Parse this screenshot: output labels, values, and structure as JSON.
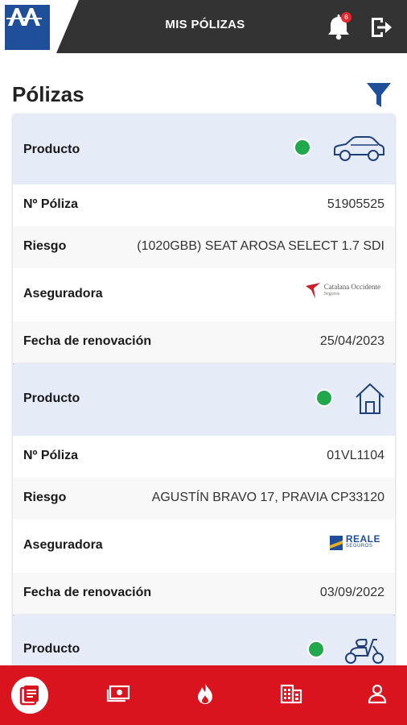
{
  "header": {
    "title": "MIS PÓLIZAS",
    "notification_count": "6",
    "brand_color": "#1f4f9a",
    "bar_color": "#333333"
  },
  "page": {
    "title": "Pólizas"
  },
  "policies": [
    {
      "product_label": "Producto",
      "product_icon": "car-icon",
      "status_color": "#21a84d",
      "rows": [
        {
          "key": "Nº Póliza",
          "value": "51905525"
        },
        {
          "key": "Riesgo",
          "value": "(1020GBB) SEAT AROSA SELECT 1.7 SDI"
        },
        {
          "key": "Aseguradora",
          "insurer": "Catalana Occidente",
          "insurer_sub": "Seguros"
        },
        {
          "key": "Fecha de renovación",
          "value": "25/04/2023"
        }
      ]
    },
    {
      "product_label": "Producto",
      "product_icon": "house-icon",
      "status_color": "#21a84d",
      "rows": [
        {
          "key": "Nº Póliza",
          "value": "01VL1104"
        },
        {
          "key": "Riesgo",
          "value": "AGUSTÍN BRAVO 17, PRAVIA CP33120"
        },
        {
          "key": "Aseguradora",
          "insurer": "REALE",
          "insurer_sub": "SEGUROS"
        },
        {
          "key": "Fecha de renovación",
          "value": "03/09/2022"
        }
      ]
    },
    {
      "product_label": "Producto",
      "product_icon": "scooter-icon",
      "status_color": "#21a84d"
    }
  ],
  "bottom_nav": {
    "color": "#d9141e",
    "items": [
      "policies-icon",
      "payments-icon",
      "claims-icon",
      "office-icon",
      "profile-icon"
    ]
  }
}
